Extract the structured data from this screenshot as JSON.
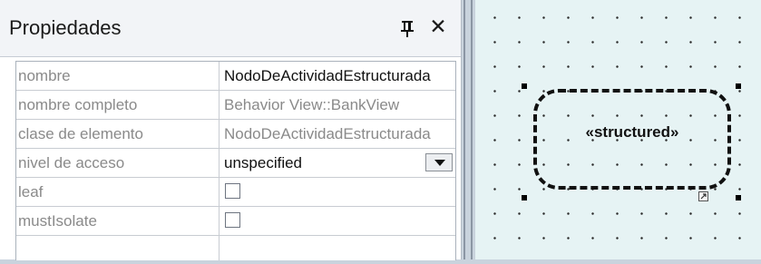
{
  "panel": {
    "title": "Propiedades",
    "pin_icon": "pin-icon",
    "close_icon": "close-icon",
    "close_glyph": "✕"
  },
  "properties": [
    {
      "name": "nombre",
      "value": "NodoDeActividadEstructurada"
    },
    {
      "name": "nombre completo",
      "value": "Behavior View::BankView"
    },
    {
      "name": "clase de elemento",
      "value": "NodoDeActividadEstructurada"
    },
    {
      "name": "nivel de acceso",
      "value": "unspecified"
    },
    {
      "name": "leaf",
      "checked": false
    },
    {
      "name": "mustIsolate",
      "checked": false
    },
    {
      "name": "",
      "value": ""
    }
  ],
  "diagram": {
    "node_label": "«structured»"
  }
}
